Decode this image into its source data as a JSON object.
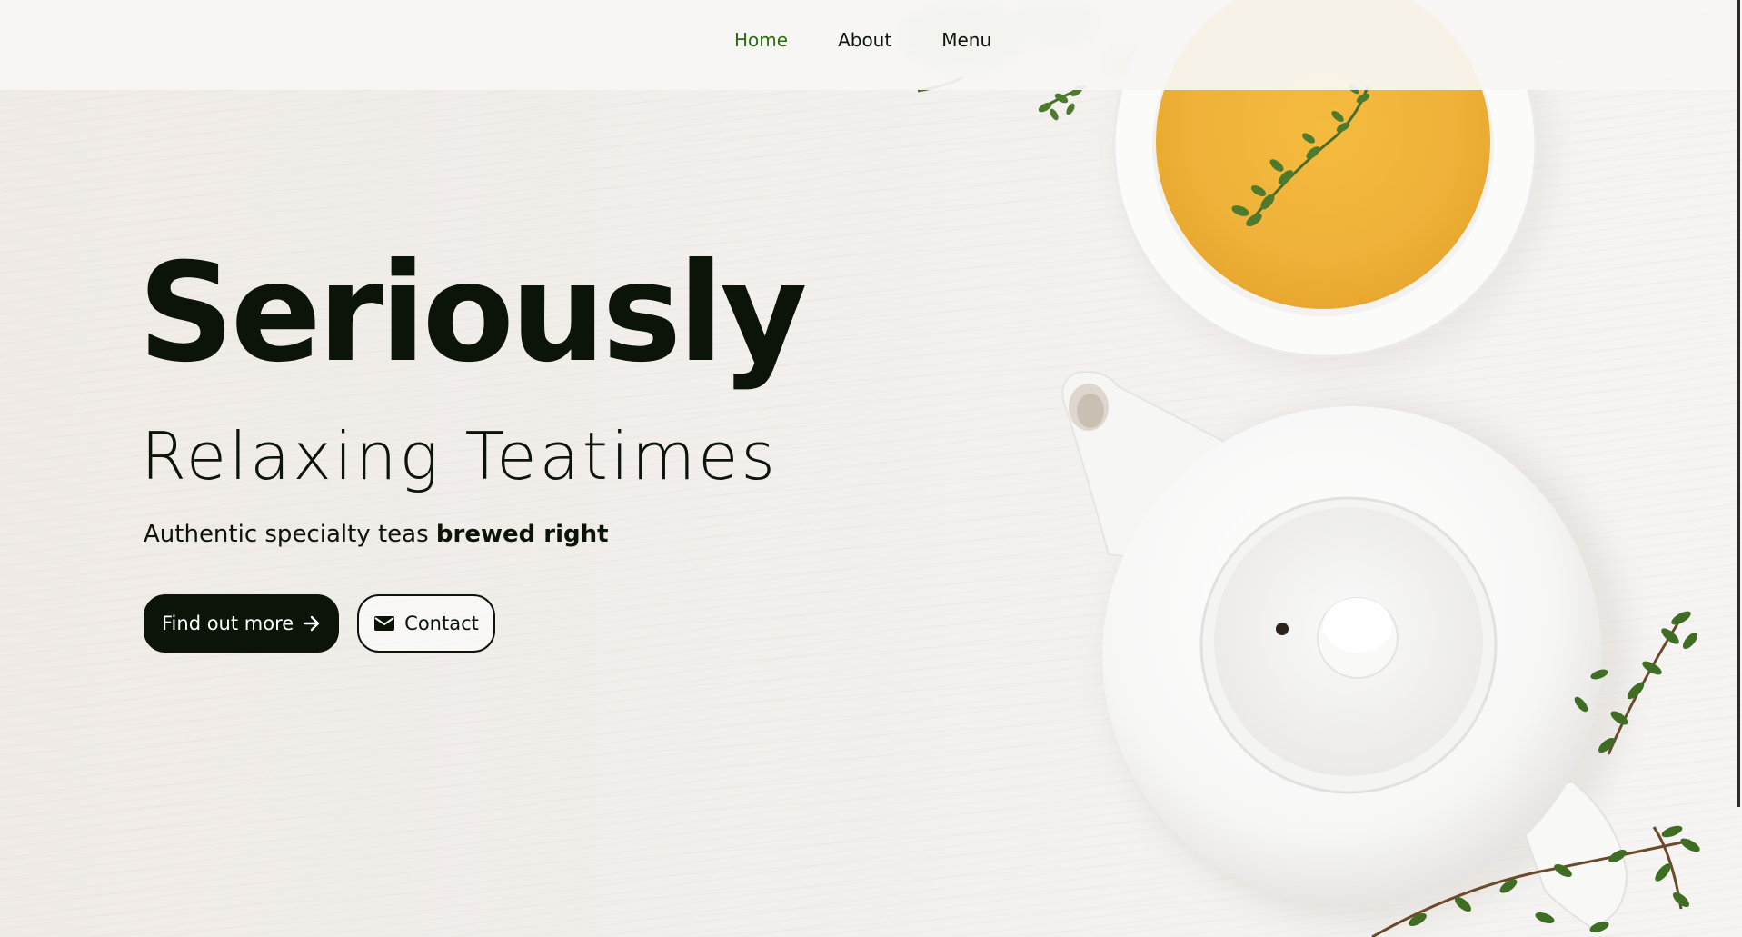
{
  "nav": {
    "items": [
      {
        "label": "Home",
        "active": true
      },
      {
        "label": "About",
        "active": false
      },
      {
        "label": "Menu",
        "active": false
      }
    ]
  },
  "hero": {
    "title": "Seriously",
    "subtitle": "Relaxing Teatimes",
    "tagline_plain": "Authentic specialty teas",
    "tagline_bold": "brewed right",
    "primary_button": {
      "label": "Find out more",
      "icon": "arrow-right-icon"
    },
    "secondary_button": {
      "label": "Contact",
      "icon": "envelope-icon"
    }
  },
  "colors": {
    "text_dark": "#0c1409",
    "nav_active": "#2f6a12",
    "tea": "#f0b23a",
    "herb": "#4e7a2e"
  }
}
